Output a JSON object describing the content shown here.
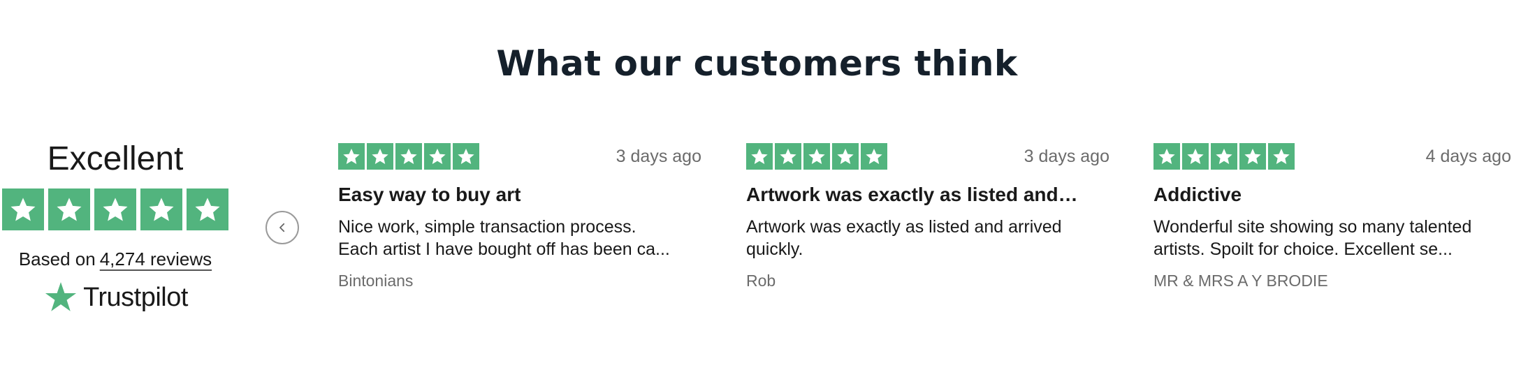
{
  "heading": "What our customers think",
  "summary": {
    "rating_word": "Excellent",
    "stars": 5,
    "based_on": "Based on",
    "review_count": "4,274 reviews",
    "brand": "Trustpilot",
    "star_color": "#52b47e"
  },
  "carousel": {
    "prev_icon": "chevron-left-icon"
  },
  "reviews": [
    {
      "stars": 5,
      "date": "3 days ago",
      "title": "Easy way to buy art",
      "body_line1": "Nice work, simple transaction process.",
      "body_line2": "Each artist I have bought off has been ca...",
      "author": "Bintonians"
    },
    {
      "stars": 5,
      "date": "3 days ago",
      "title": "Artwork was exactly as listed and…",
      "body_line1": "Artwork was exactly as listed and arrived",
      "body_line2": "quickly.",
      "author": "Rob"
    },
    {
      "stars": 5,
      "date": "4 days ago",
      "title": "Addictive",
      "body_line1": "Wonderful site showing so many talented",
      "body_line2": "artists. Spoilt for choice. Excellent se...",
      "author": "MR & MRS A Y BRODIE"
    }
  ]
}
